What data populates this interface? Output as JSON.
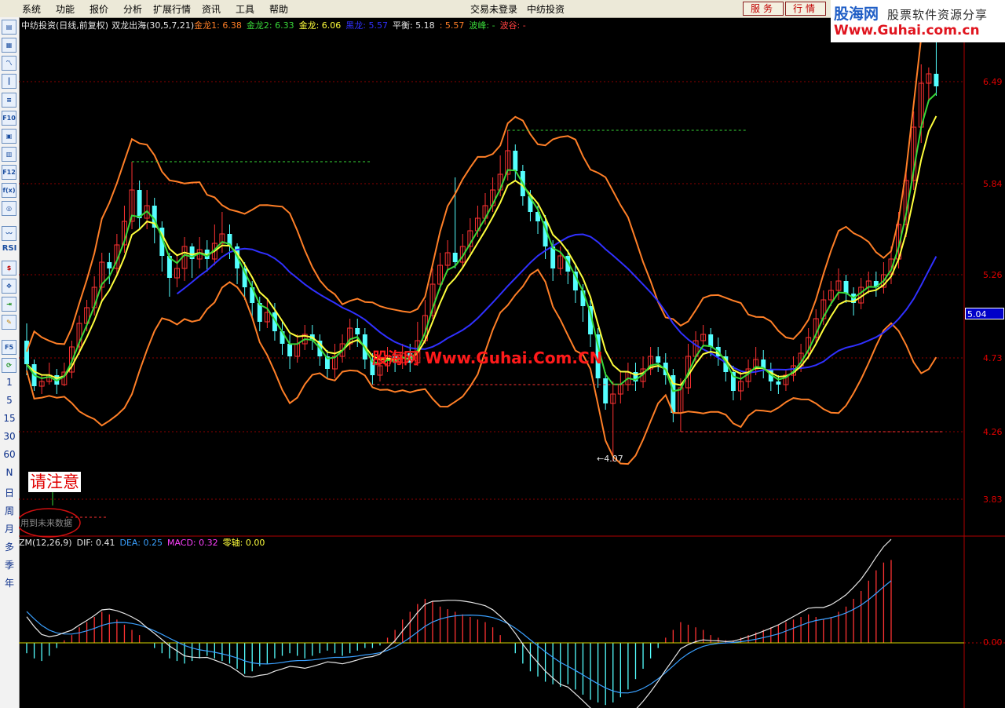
{
  "menu": {
    "items": [
      "系统",
      "功能",
      "报价",
      "分析",
      "扩展行情",
      "资讯",
      "工具",
      "帮助"
    ],
    "login_status": "交易未登录",
    "stock_title": "中纺投资",
    "service_button": "服务",
    "quote_button": "行情"
  },
  "logo": {
    "brand": "股海网",
    "tagline": "股票软件资源分享",
    "url": "Www.Guhai.com.cn"
  },
  "toolbar": {
    "period_buttons": [
      "1",
      "5",
      "15",
      "30",
      "60",
      "N",
      "日",
      "周",
      "月",
      "多",
      "季",
      "年"
    ],
    "icons": [
      "chart-icon",
      "grid-icon",
      "line-chart-icon",
      "candle-icon",
      "list-icon",
      "f10-icon",
      "report-icon",
      "notes-icon",
      "f12-icon",
      "formula-icon",
      "search-icon",
      "indicator-icon",
      "rsi-icon",
      "money-icon",
      "move-icon",
      "export-icon",
      "pencil-icon",
      "f5-icon",
      "refresh-icon"
    ],
    "rsi_label": "RSI"
  },
  "main_info": {
    "stock": "中纺投资(日线,前复权)",
    "indicator": "双龙出海(30,5,7,21)",
    "items": [
      {
        "label": "金龙1: 6.38",
        "color": "#ff7f27"
      },
      {
        "label": "金龙2: 6.33",
        "color": "#39d839"
      },
      {
        "label": "金龙: 6.06",
        "color": "#ffff3c"
      },
      {
        "label": "黑龙: 5.57",
        "color": "#3030ff"
      },
      {
        "label": "平衡: 5.18",
        "color": "#e6e6e6"
      },
      {
        "label": ": 5.57",
        "color": "#ff7f27"
      },
      {
        "label": "波峰: -",
        "color": "#39d839"
      },
      {
        "label": "波谷: -",
        "color": "#ff4040"
      }
    ]
  },
  "price_axis": {
    "ticks": [
      "6.49",
      "5.84",
      "5.26",
      "4.73",
      "4.26",
      "3.83"
    ],
    "current_price": "5.04"
  },
  "annotations": {
    "low_marker": "←4.07",
    "notice": "请注意",
    "future_data": "用到未来数据",
    "watermark": "股海网 Www.Guhai.Com.CN"
  },
  "macd_info": {
    "items": [
      {
        "label": "ZM(12,26,9)",
        "color": "#e6e6e6"
      },
      {
        "label": "DIF: 0.41",
        "color": "#e6e6e6"
      },
      {
        "label": "DEA: 0.25",
        "color": "#3aa0ff"
      },
      {
        "label": "MACD: 0.32",
        "color": "#ff40ff"
      },
      {
        "label": "零轴: 0.00",
        "color": "#ffff3c"
      }
    ],
    "zero_tick": "0.00"
  },
  "colors": {
    "up": "#ff3232",
    "down": "#54ffff",
    "band": "#ff7f27",
    "gold2": "#39d839",
    "gold": "#ffff3c",
    "black_dragon": "#3030ff",
    "grid": "#8b0000"
  },
  "chart_data": {
    "type": "candlestick",
    "price_ticks": [
      6.49,
      5.84,
      5.26,
      4.73,
      4.26,
      3.83
    ],
    "yrange": [
      3.6,
      6.9
    ],
    "visible_low": 4.07,
    "last_price": 5.04,
    "candles": [
      [
        4.84,
        4.69,
        4.95,
        4.62
      ],
      [
        4.69,
        4.55,
        4.72,
        4.52
      ],
      [
        4.55,
        4.58,
        4.62,
        4.5
      ],
      [
        4.58,
        4.62,
        4.7,
        4.56
      ],
      [
        4.62,
        4.56,
        4.66,
        4.5
      ],
      [
        4.56,
        4.64,
        4.7,
        4.55
      ],
      [
        4.64,
        4.8,
        4.84,
        4.6
      ],
      [
        4.8,
        4.95,
        5.0,
        4.75
      ],
      [
        4.95,
        5.05,
        5.1,
        4.9
      ],
      [
        5.05,
        5.18,
        5.25,
        5.0
      ],
      [
        5.18,
        5.34,
        5.4,
        5.1
      ],
      [
        5.34,
        5.3,
        5.4,
        5.2
      ],
      [
        5.3,
        5.45,
        5.52,
        5.25
      ],
      [
        5.45,
        5.6,
        5.7,
        5.4
      ],
      [
        5.6,
        5.8,
        5.98,
        5.55
      ],
      [
        5.8,
        5.62,
        5.86,
        5.55
      ],
      [
        5.62,
        5.7,
        5.8,
        5.55
      ],
      [
        5.7,
        5.56,
        5.75,
        5.46
      ],
      [
        5.56,
        5.38,
        5.6,
        5.28
      ],
      [
        5.38,
        5.24,
        5.4,
        5.12
      ],
      [
        5.24,
        5.3,
        5.38,
        5.18
      ],
      [
        5.3,
        5.44,
        5.5,
        5.22
      ],
      [
        5.44,
        5.36,
        5.46,
        5.24
      ],
      [
        5.36,
        5.42,
        5.5,
        5.3
      ],
      [
        5.42,
        5.36,
        5.48,
        5.28
      ],
      [
        5.36,
        5.46,
        5.58,
        5.32
      ],
      [
        5.46,
        5.52,
        5.66,
        5.4
      ],
      [
        5.52,
        5.44,
        5.58,
        5.36
      ],
      [
        5.44,
        5.3,
        5.46,
        5.2
      ],
      [
        5.3,
        5.18,
        5.34,
        5.1
      ],
      [
        5.18,
        5.08,
        5.22,
        4.98
      ],
      [
        5.08,
        4.96,
        5.12,
        4.9
      ],
      [
        4.96,
        5.02,
        5.1,
        4.92
      ],
      [
        5.02,
        4.9,
        5.08,
        4.84
      ],
      [
        4.9,
        4.82,
        4.96,
        4.75
      ],
      [
        4.82,
        4.74,
        4.88,
        4.66
      ],
      [
        4.74,
        4.82,
        4.88,
        4.7
      ],
      [
        4.82,
        4.88,
        4.94,
        4.78
      ],
      [
        4.88,
        4.84,
        4.94,
        4.78
      ],
      [
        4.84,
        4.74,
        4.88,
        4.68
      ],
      [
        4.74,
        4.66,
        4.78,
        4.6
      ],
      [
        4.66,
        4.74,
        4.82,
        4.6
      ],
      [
        4.74,
        4.82,
        4.88,
        4.7
      ],
      [
        4.82,
        4.92,
        4.98,
        4.78
      ],
      [
        4.92,
        4.88,
        4.98,
        4.8
      ],
      [
        4.88,
        4.72,
        4.92,
        4.66
      ],
      [
        4.72,
        4.62,
        4.76,
        4.56
      ],
      [
        4.62,
        4.68,
        4.74,
        4.58
      ],
      [
        4.68,
        4.74,
        4.8,
        4.64
      ],
      [
        4.74,
        4.7,
        4.78,
        4.64
      ],
      [
        4.7,
        4.76,
        4.82,
        4.66
      ],
      [
        4.76,
        4.7,
        4.82,
        4.64
      ],
      [
        4.7,
        4.84,
        4.96,
        4.68
      ],
      [
        4.84,
        5.0,
        5.1,
        4.82
      ],
      [
        5.0,
        5.2,
        5.3,
        4.98
      ],
      [
        5.2,
        5.32,
        5.4,
        5.16
      ],
      [
        5.32,
        5.4,
        5.48,
        5.28
      ],
      [
        5.4,
        5.34,
        5.88,
        5.3
      ],
      [
        5.34,
        5.44,
        5.52,
        5.3
      ],
      [
        5.44,
        5.54,
        5.62,
        5.4
      ],
      [
        5.54,
        5.62,
        5.7,
        5.5
      ],
      [
        5.62,
        5.7,
        5.78,
        5.58
      ],
      [
        5.7,
        5.8,
        5.88,
        5.66
      ],
      [
        5.8,
        5.9,
        6.02,
        5.76
      ],
      [
        5.9,
        6.05,
        6.18,
        5.86
      ],
      [
        6.05,
        5.92,
        6.09,
        5.86
      ],
      [
        5.92,
        5.76,
        5.96,
        5.7
      ],
      [
        5.76,
        5.66,
        5.8,
        5.6
      ],
      [
        5.66,
        5.6,
        5.7,
        5.52
      ],
      [
        5.6,
        5.44,
        5.64,
        5.36
      ],
      [
        5.44,
        5.3,
        5.48,
        5.22
      ],
      [
        5.3,
        5.38,
        5.44,
        5.26
      ],
      [
        5.38,
        5.28,
        5.42,
        5.2
      ],
      [
        5.28,
        5.16,
        5.32,
        5.08
      ],
      [
        5.16,
        5.06,
        5.2,
        4.96
      ],
      [
        5.06,
        4.88,
        5.1,
        4.8
      ],
      [
        4.88,
        4.6,
        4.92,
        4.54
      ],
      [
        4.6,
        4.44,
        4.64,
        4.4
      ],
      [
        4.44,
        4.5,
        4.58,
        4.07
      ],
      [
        4.5,
        4.56,
        4.64,
        4.44
      ],
      [
        4.56,
        4.64,
        4.7,
        4.52
      ],
      [
        4.64,
        4.58,
        4.7,
        4.52
      ],
      [
        4.58,
        4.66,
        4.74,
        4.54
      ],
      [
        4.66,
        4.74,
        4.8,
        4.62
      ],
      [
        4.74,
        4.7,
        4.8,
        4.64
      ],
      [
        4.7,
        4.62,
        4.76,
        4.56
      ],
      [
        4.62,
        4.38,
        4.66,
        4.32
      ],
      [
        4.38,
        4.54,
        4.6,
        4.26
      ],
      [
        4.54,
        4.74,
        4.82,
        4.5
      ],
      [
        4.74,
        4.84,
        4.9,
        4.7
      ],
      [
        4.84,
        4.88,
        4.94,
        4.8
      ],
      [
        4.88,
        4.8,
        4.92,
        4.74
      ],
      [
        4.8,
        4.74,
        4.86,
        4.68
      ],
      [
        4.74,
        4.64,
        4.78,
        4.58
      ],
      [
        4.64,
        4.52,
        4.68,
        4.46
      ],
      [
        4.52,
        4.58,
        4.64,
        4.46
      ],
      [
        4.58,
        4.66,
        4.72,
        4.54
      ],
      [
        4.66,
        4.72,
        4.8,
        4.62
      ],
      [
        4.72,
        4.66,
        4.78,
        4.6
      ],
      [
        4.66,
        4.58,
        4.7,
        4.52
      ],
      [
        4.58,
        4.56,
        4.62,
        4.5
      ],
      [
        4.56,
        4.62,
        4.66,
        4.52
      ],
      [
        4.62,
        4.68,
        4.74,
        4.58
      ],
      [
        4.68,
        4.76,
        4.82,
        4.64
      ],
      [
        4.76,
        4.86,
        4.92,
        4.72
      ],
      [
        4.86,
        4.98,
        5.04,
        4.82
      ],
      [
        4.98,
        5.1,
        5.16,
        4.94
      ],
      [
        5.1,
        5.16,
        5.22,
        5.06
      ],
      [
        5.16,
        5.22,
        5.3,
        5.1
      ],
      [
        5.22,
        5.14,
        5.26,
        5.08
      ],
      [
        5.14,
        5.08,
        5.18,
        5.0
      ],
      [
        5.08,
        5.18,
        5.24,
        5.04
      ],
      [
        5.18,
        5.22,
        5.28,
        5.14
      ],
      [
        5.22,
        5.18,
        5.28,
        5.12
      ],
      [
        5.18,
        5.26,
        5.34,
        5.14
      ],
      [
        5.26,
        5.36,
        5.44,
        5.2
      ],
      [
        5.36,
        5.58,
        5.66,
        5.3
      ],
      [
        5.58,
        5.86,
        5.94,
        5.5
      ],
      [
        5.86,
        6.2,
        6.3,
        5.8
      ],
      [
        6.2,
        6.48,
        6.6,
        6.1
      ],
      [
        6.48,
        6.54,
        6.58,
        6.36
      ],
      [
        6.54,
        6.46,
        6.9,
        6.4
      ]
    ],
    "macd_hist": [
      -0.04,
      -0.06,
      -0.07,
      -0.05,
      -0.02,
      0.01,
      0.03,
      0.06,
      0.08,
      0.1,
      0.12,
      0.11,
      0.09,
      0.07,
      0.05,
      0.03,
      0.0,
      -0.02,
      -0.04,
      -0.06,
      -0.07,
      -0.08,
      -0.07,
      -0.06,
      -0.05,
      -0.06,
      -0.07,
      -0.08,
      -0.1,
      -0.12,
      -0.11,
      -0.09,
      -0.08,
      -0.06,
      -0.05,
      -0.04,
      -0.05,
      -0.06,
      -0.05,
      -0.04,
      -0.03,
      -0.04,
      -0.05,
      -0.04,
      -0.03,
      -0.02,
      -0.02,
      -0.01,
      0.02,
      0.05,
      0.09,
      0.12,
      0.15,
      0.17,
      0.16,
      0.14,
      0.13,
      0.12,
      0.11,
      0.1,
      0.09,
      0.08,
      0.06,
      0.03,
      0.0,
      -0.04,
      -0.08,
      -0.11,
      -0.13,
      -0.15,
      -0.16,
      -0.17,
      -0.16,
      -0.18,
      -0.2,
      -0.22,
      -0.23,
      -0.24,
      -0.23,
      -0.21,
      -0.18,
      -0.14,
      -0.1,
      -0.06,
      -0.02,
      0.02,
      0.05,
      0.08,
      0.07,
      0.06,
      0.05,
      0.03,
      0.02,
      0.01,
      0.01,
      0.02,
      0.03,
      0.04,
      0.05,
      0.06,
      0.07,
      0.08,
      0.09,
      0.1,
      0.11,
      0.1,
      0.09,
      0.1,
      0.12,
      0.14,
      0.17,
      0.2,
      0.24,
      0.28,
      0.31,
      0.32
    ]
  }
}
